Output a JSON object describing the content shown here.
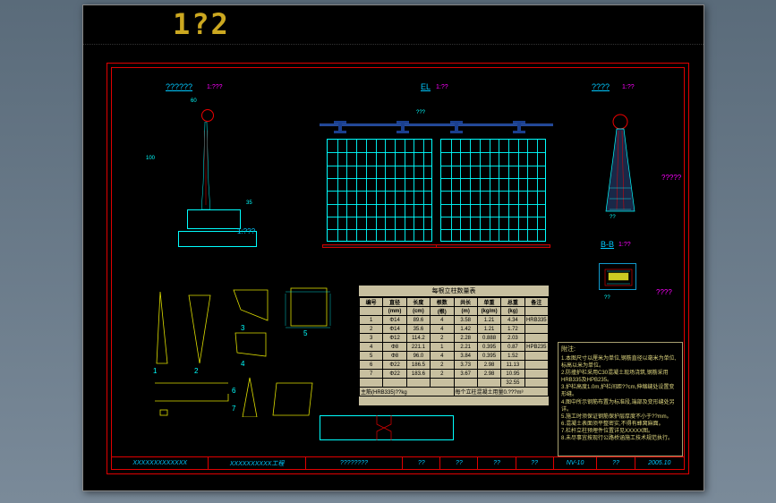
{
  "window": {
    "title": "1?2"
  },
  "headers": {
    "section_a": "??????",
    "elevation": "EL",
    "post_detail": "????",
    "section_b": "B-B",
    "post_side_label": "?????",
    "detail_side_label": "????"
  },
  "notes": {
    "title": "附注:",
    "lines": [
      "1.本图尺寸以厘米为单位,钢筋直径以毫米为单位,标高以米为单位。",
      "2.防撞护栏采用C30混凝土现场浇筑,钢筋采用HRB335及HPB235。",
      "3.护栏高度1.0m,护栏间距??cm,伸缩缝处设置变形缝。",
      "4.图中所示钢筋布置为标准段,端部及变形缝处另详。",
      "5.施工时须保证钢筋保护层厚度不小于??mm。",
      "6.混凝土表面须平整密实,不得有蜂窝麻面。",
      "7.栏杆立柱预埋件位置详见XXXXX图。",
      "8.未尽事宜按现行公路桥涵施工技术规范执行。"
    ]
  },
  "table": {
    "title": "每根立柱数量表",
    "headers": [
      "编号",
      "直径",
      "长度",
      "根数",
      "共长",
      "单重",
      "总重",
      "备注"
    ],
    "units": [
      "",
      "(mm)",
      "(cm)",
      "(根)",
      "(m)",
      "(kg/m)",
      "(kg)",
      ""
    ],
    "rows": [
      [
        "1",
        "Φ14",
        "89.6",
        "4",
        "3.58",
        "1.21",
        "4.34",
        "HRB335"
      ],
      [
        "2",
        "Φ14",
        "35.6",
        "4",
        "1.42",
        "1.21",
        "1.72",
        ""
      ],
      [
        "3",
        "Φ12",
        "114.2",
        "2",
        "2.28",
        "0.888",
        "2.03",
        ""
      ],
      [
        "4",
        "Φ8",
        "221.1",
        "1",
        "2.21",
        "0.395",
        "0.87",
        "HPB235"
      ],
      [
        "5",
        "Φ8",
        "96.0",
        "4",
        "3.84",
        "0.395",
        "1.52",
        ""
      ],
      [
        "6",
        "Φ22",
        "186.5",
        "2",
        "3.73",
        "2.98",
        "11.13",
        ""
      ],
      [
        "7",
        "Φ22",
        "183.6",
        "2",
        "3.67",
        "2.98",
        "10.95",
        ""
      ],
      [
        "",
        "",
        "",
        "",
        "",
        "",
        "32.55",
        ""
      ]
    ],
    "footnote_l": "主筋(HRB335)??kg",
    "footnote_r": "每个立柱混凝土用量0.???m³"
  },
  "title_block": {
    "cells": [
      "XXXXXXXXXXXXX",
      "XXXXXXXXXX工程",
      "????????",
      "??",
      "??",
      "??",
      "??",
      "NV-10",
      "??",
      "2005.10"
    ]
  },
  "dims": {
    "section_top": "60",
    "section_h1": "100",
    "section_h2": "35",
    "elev_span": "???",
    "post_w": "??",
    "bb_w": "??"
  },
  "scale_labels": {
    "s1": "1:???",
    "s2": "1:??",
    "s3": "1:??"
  },
  "component_labels": {
    "c1": "1",
    "c2": "2",
    "c3": "3",
    "c4": "4",
    "c5": "5",
    "c6": "6",
    "c7": "7"
  }
}
